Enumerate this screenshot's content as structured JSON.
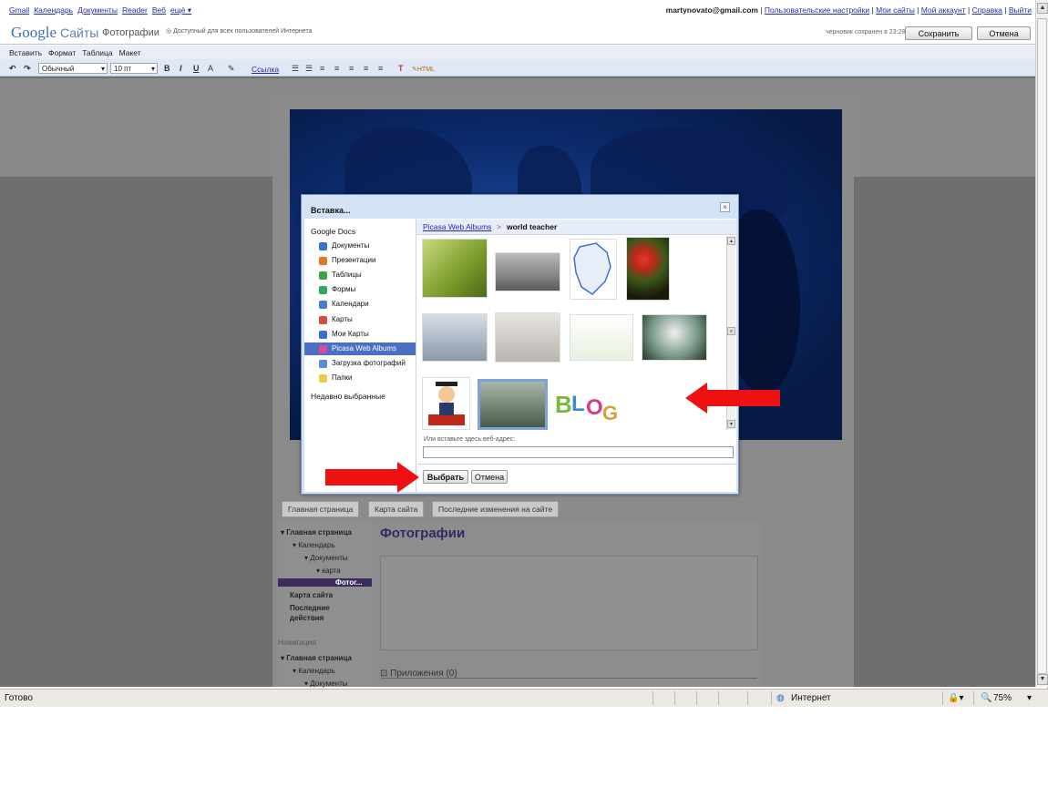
{
  "gbar": {
    "links": [
      "Gmail",
      "Календарь",
      "Документы",
      "Reader",
      "Веб",
      "ещё ▾"
    ],
    "email": "martynovato@gmail.com",
    "right_links": [
      "Пользовательские настройки",
      "Мои сайты",
      "Мой аккаунт",
      "Справка",
      "Выйти"
    ]
  },
  "sites": {
    "logo": "Google",
    "product": "Сайты",
    "page_name": "Фотографии",
    "access": "Доступный для всех пользователей Интернета",
    "draft": "черновик сохранен в 23:28",
    "save_label": "Сохранить",
    "cancel_label": "Отмена"
  },
  "menubar": [
    "Вставить",
    "Формат",
    "Таблица",
    "Макет"
  ],
  "toolbar": {
    "style_select": "Обычный",
    "size_select": "10 пт",
    "bold": "B",
    "italic": "I",
    "underline": "U",
    "text_color": "A",
    "link": "Ссылка",
    "html": "HTML"
  },
  "page": {
    "tabs": [
      "Главная страница",
      "Карта сайта",
      "Последние изменения на сайте"
    ],
    "nav_items": [
      {
        "label": "▾ Главная страница",
        "bold": true
      },
      {
        "label": "▾ Календарь",
        "bold": false
      },
      {
        "label": "▾ Документы",
        "bold": false
      },
      {
        "label": "▾ карта",
        "bold": false
      },
      {
        "label": "Фотог...",
        "bold": true,
        "selected": true
      },
      {
        "label": "Карта сайта",
        "bold": true
      },
      {
        "label": "Последние",
        "bold": true
      },
      {
        "label": "действия",
        "bold": true
      }
    ],
    "nav_section": "Навигация",
    "nav_items_2": [
      "▾ Главная страница",
      "▾ Календарь",
      "▾ Документы"
    ],
    "title": "Фотографии",
    "attachments": "Приложения (0)"
  },
  "dialog": {
    "title": "Вставка...",
    "close": "×",
    "section": "Google Docs",
    "items": [
      {
        "label": "Документы",
        "icon": "document-icon",
        "color": "#3a6fd8"
      },
      {
        "label": "Презентации",
        "icon": "presentation-icon",
        "color": "#e0752c"
      },
      {
        "label": "Таблицы",
        "icon": "spreadsheet-icon",
        "color": "#3aa44a"
      },
      {
        "label": "Формы",
        "icon": "form-icon",
        "color": "#2ea862"
      },
      {
        "label": "Календари",
        "icon": "calendar-icon",
        "color": "#4a7ad8"
      },
      {
        "label": "Карты",
        "icon": "map-pin-icon",
        "color": "#d84a3a"
      },
      {
        "label": "Мои Карты",
        "icon": "map-pin-blue-icon",
        "color": "#3a6fd8"
      },
      {
        "label": "Picasa Web Albums",
        "icon": "picasa-icon",
        "color": "#d84aa0",
        "active": true
      },
      {
        "label": "Загрузка фотографий",
        "icon": "upload-icon",
        "color": "#5a8ad8"
      },
      {
        "label": "Папки",
        "icon": "folder-icon",
        "color": "#f2c84a"
      }
    ],
    "recent": "Недавно выбранные",
    "crumb_link": "Picasa Web Albums",
    "crumb_sep": ">",
    "crumb_current": "world teacher",
    "url_label": "Или вставьте здесь веб-адрес:",
    "url_value": "",
    "select_label": "Выбрать",
    "cancel_label": "Отмена"
  },
  "status": {
    "text": "Готово",
    "zone": "Интернет",
    "zoom": "75%"
  }
}
